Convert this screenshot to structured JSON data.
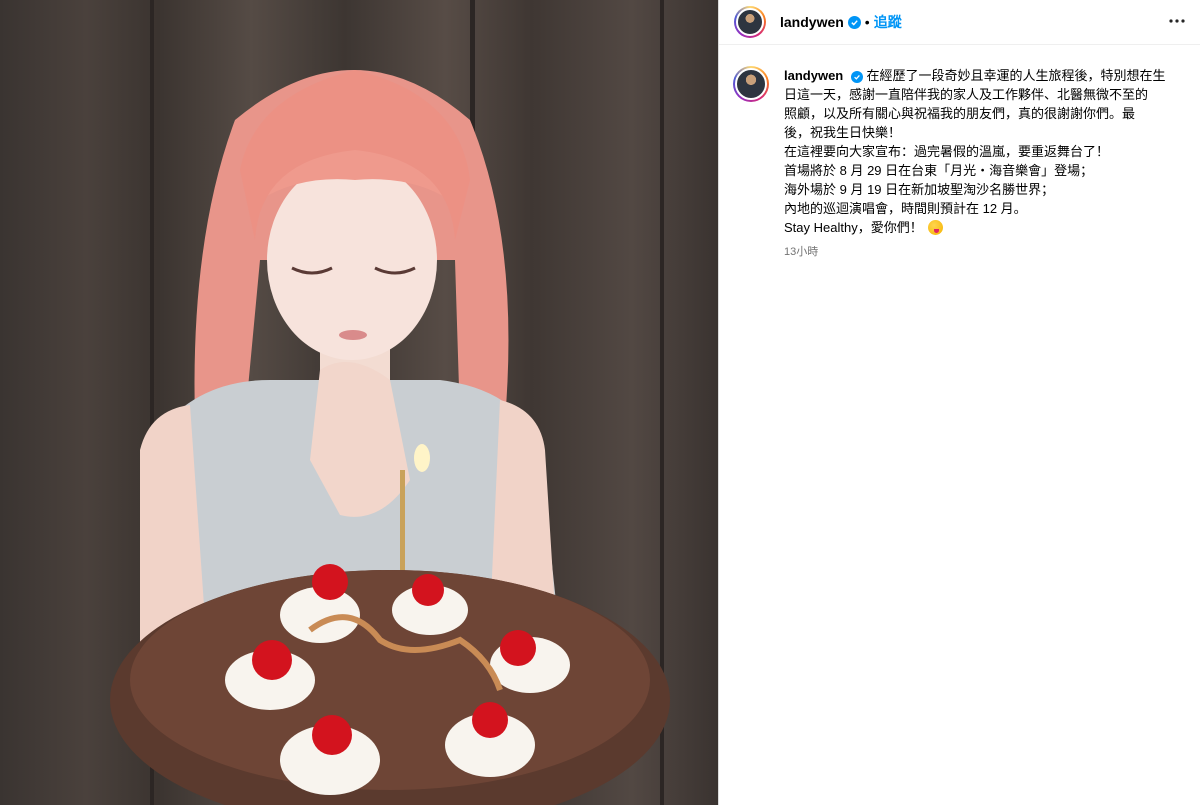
{
  "post": {
    "username": "landywen",
    "dot": "•",
    "follow_label": "追蹤",
    "caption_lines": [
      "在經歷了一段奇妙且幸運的人生旅程後，特別想在生",
      "日這一天，感謝一直陪伴我的家人及工作夥伴、北醫無微不至的",
      "照顧，以及所有關心與祝福我的朋友們，真的很謝謝你們。最",
      "後，祝我生日快樂！",
      "在這裡要向大家宣布：過完暑假的溫嵐，要重返舞台了！",
      "首場將於 8 月 29 日在台東「月光・海音樂會」登場；",
      "海外場於 9 月 19 日在新加坡聖淘沙名勝世界；",
      "內地的巡迴演唱會，時間則預計在 12 月。",
      "Stay Healthy，愛你們！"
    ],
    "time_ago": "13小時"
  },
  "icons": {
    "verified": "verified-badge-icon",
    "more": "more-options-icon",
    "emoji": "winking-kiss-emoji-icon"
  },
  "colors": {
    "accent": "#0095f6",
    "muted": "#737373"
  }
}
